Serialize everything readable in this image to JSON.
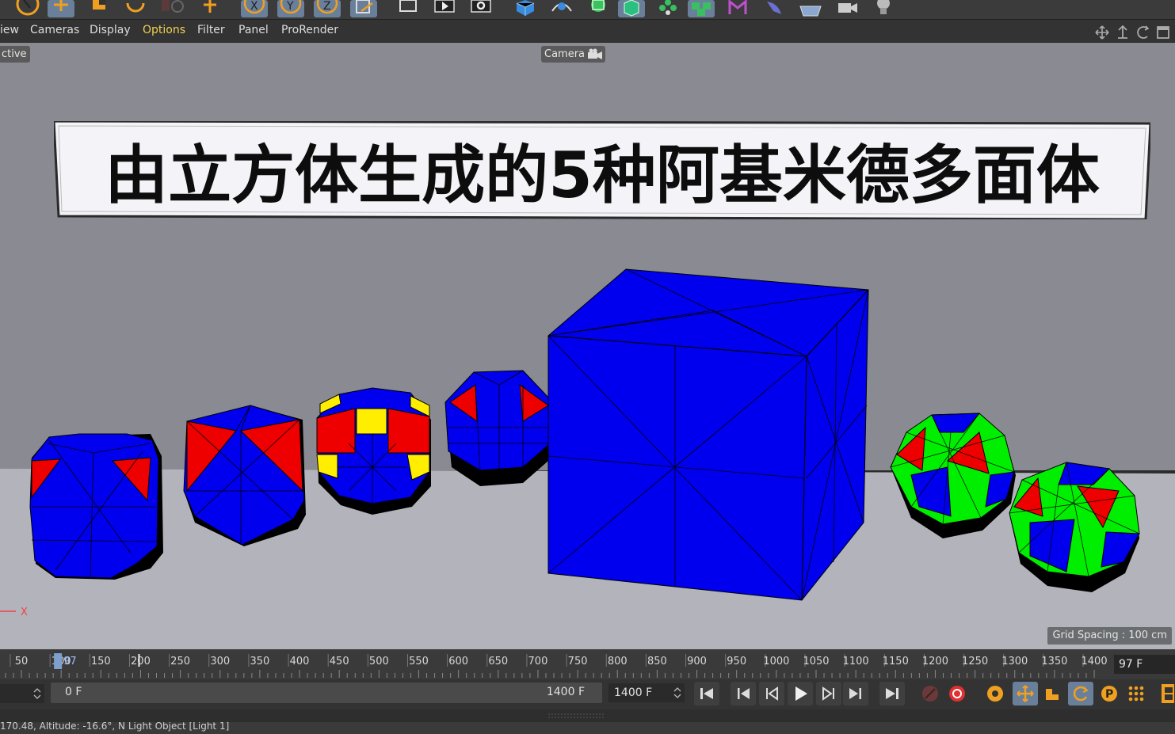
{
  "toolbar": {
    "icons": [
      "live-select-icon",
      "move-icon",
      "scale-icon",
      "rotate-icon",
      "recent-icon",
      "add-icon",
      "x-axis-icon",
      "y-axis-icon",
      "z-axis-icon",
      "world-coord-icon",
      "render-region-icon",
      "render-view-icon",
      "render-settings-icon",
      "cube-icon",
      "spline-pen-icon",
      "subdivision-icon",
      "array-icon",
      "sweep-icon",
      "cloner-icon",
      "mograph-icon",
      "deformer-icon",
      "sculpt-icon",
      "floor-icon",
      "camera-icon",
      "light-icon"
    ]
  },
  "menu": {
    "items": [
      "iew",
      "Cameras",
      "Display",
      "Options",
      "Filter",
      "Panel",
      "ProRender"
    ],
    "active": "Options"
  },
  "viewport": {
    "view_label": "ctive",
    "camera_label": "Camera",
    "grid_spacing": "Grid Spacing : 100 cm",
    "axis_label": "X",
    "title": "由立方体生成的5种阿基米德多面体",
    "background_color": "#8a8a93",
    "floor_color": "#b3b3bb",
    "colors": {
      "blue": "#0000ee",
      "red": "#ee0000",
      "yellow": "#ffee00",
      "green": "#00ee00",
      "black": "#000000"
    }
  },
  "timeline": {
    "ticks": [
      "50",
      "100",
      "150",
      "200",
      "250",
      "300",
      "350",
      "400",
      "450",
      "500",
      "550",
      "600",
      "650",
      "700",
      "750",
      "800",
      "850",
      "900",
      "950",
      "1000",
      "1050",
      "1100",
      "1150",
      "1200",
      "1250",
      "1300",
      "1350",
      "1400"
    ],
    "marker_label": "97",
    "current_frame": "97 F"
  },
  "controls": {
    "start_frame": "0 F",
    "end_frame": "1400 F",
    "max_frame": "1400 F"
  },
  "status": {
    "text": "170.48, Altitude: -16.6°, N     Light Object [Light 1]"
  }
}
